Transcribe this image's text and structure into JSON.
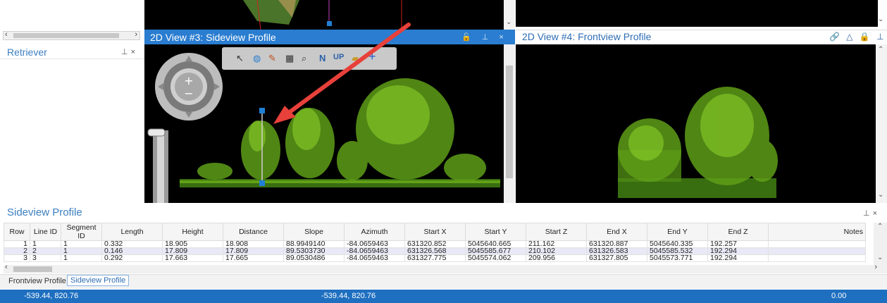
{
  "left_panel": {
    "retriever_title": "Retriever",
    "pin_icon": "⊥",
    "close_icon": "×"
  },
  "view3": {
    "title": "2D View #3: Sideview Profile",
    "bar_icons": "🔓 ⊥ ×"
  },
  "view4": {
    "title": "2D View #4: Frontview Profile",
    "bar_icons": "🔗 △ 🔒 ⊥ ×"
  },
  "toolbar": {
    "icons": [
      "cursor-icon",
      "globe-icon",
      "paint-icon",
      "grid-icon",
      "zoom-icon",
      "north-icon",
      "up-icon",
      "folder-icon",
      "crosshair-icon"
    ],
    "north_label": "N",
    "up_label": "UP"
  },
  "sideview_profile": {
    "title": "Sideview Profile",
    "columns": [
      "Row",
      "Line ID",
      "Segment ID",
      "Length",
      "Height",
      "Distance",
      "Slope",
      "Azimuth",
      "Start X",
      "Start Y",
      "Start Z",
      "End X",
      "End Y",
      "End Z",
      "Notes"
    ],
    "rows": [
      [
        "1",
        "1",
        "1",
        "0.332",
        "18.905",
        "18.908",
        "88.9949140",
        "-84.0659463",
        "631320.852",
        "5045640.665",
        "211.162",
        "631320.887",
        "5045640.335",
        "192.257",
        ""
      ],
      [
        "2",
        "2",
        "1",
        "0.146",
        "17.809",
        "17.809",
        "89.5303730",
        "-84.0659463",
        "631326.568",
        "5045585.677",
        "210.102",
        "631326.583",
        "5045585.532",
        "192.294",
        ""
      ],
      [
        "3",
        "3",
        "1",
        "0.292",
        "17.663",
        "17.665",
        "89.0530486",
        "-84.0659463",
        "631327.775",
        "5045574.062",
        "209.956",
        "631327.805",
        "5045573.771",
        "192.294",
        ""
      ]
    ]
  },
  "tabs": [
    "Frontview Profile",
    "Sideview Profile"
  ],
  "status": {
    "left": "-539.44, 820.76",
    "middle": "-539.44, 820.76",
    "right": "0.00"
  },
  "colors": {
    "accent": "#2a7dd0",
    "status_bar": "#1e6fc0",
    "arrow": "#e8403a",
    "vegetation": "#7fc31c"
  }
}
